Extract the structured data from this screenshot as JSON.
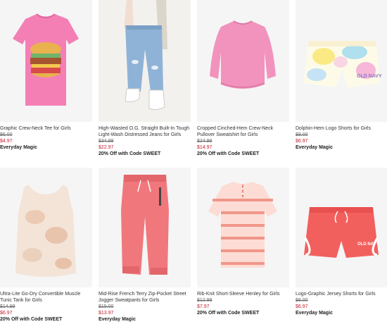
{
  "products": [
    {
      "name": "Graphic Crew-Neck Tee for Girls",
      "original_price": "$6.00",
      "sale_price": "$4.97",
      "promo": "Everyday Magic",
      "image_icon": "pink-burger-tee-image"
    },
    {
      "name": "High-Waisted O.G. Straight Built-In Tough Light-Wash Distressed Jeans for Girls",
      "original_price": "$34.99",
      "sale_price": "$22.97",
      "promo": "20% Off with Code SWEET",
      "image_icon": "distressed-jeans-image"
    },
    {
      "name": "Cropped Cinched-Hem Crew-Neck Pullover Sweatshirt for Girls",
      "original_price": "$24.99",
      "sale_price": "$14.97",
      "promo": "20% Off with Code SWEET",
      "image_icon": "pink-sweatshirt-image"
    },
    {
      "name": "Dolphin-Hem Logo Shorts for Girls",
      "original_price": "$8.00",
      "sale_price": "$6.97",
      "promo": "Everyday Magic",
      "image_icon": "tie-dye-shorts-image",
      "image_text": "OLD NAVY"
    },
    {
      "name": "Ultra-Lite Go-Dry Convertible Muscle Tunic Tank for Girls",
      "original_price": "$14.99",
      "sale_price": "$6.97",
      "promo": "20% Off with Code SWEET",
      "image_icon": "tie-dye-tank-image"
    },
    {
      "name": "Mid-Rise French Terry Zip-Pocket Street Jogger Sweatpants for Girls",
      "original_price": "$15.00",
      "sale_price": "$13.97",
      "promo": "Everyday Magic",
      "image_icon": "coral-joggers-image"
    },
    {
      "name": "Rib-Knit Short-Sleeve Henley for Girls",
      "original_price": "$12.99",
      "sale_price": "$7.97",
      "promo": "20% Off with Code SWEET",
      "image_icon": "striped-henley-image"
    },
    {
      "name": "Logo-Graphic Jersey Shorts for Girls",
      "original_price": "$8.00",
      "sale_price": "$6.97",
      "promo": "Everyday Magic",
      "image_icon": "coral-shorts-image",
      "image_text": "OLD NAVY"
    }
  ],
  "colors": {
    "sale_red": "#c0202e",
    "thumb_bg": "#f5f5f5"
  }
}
